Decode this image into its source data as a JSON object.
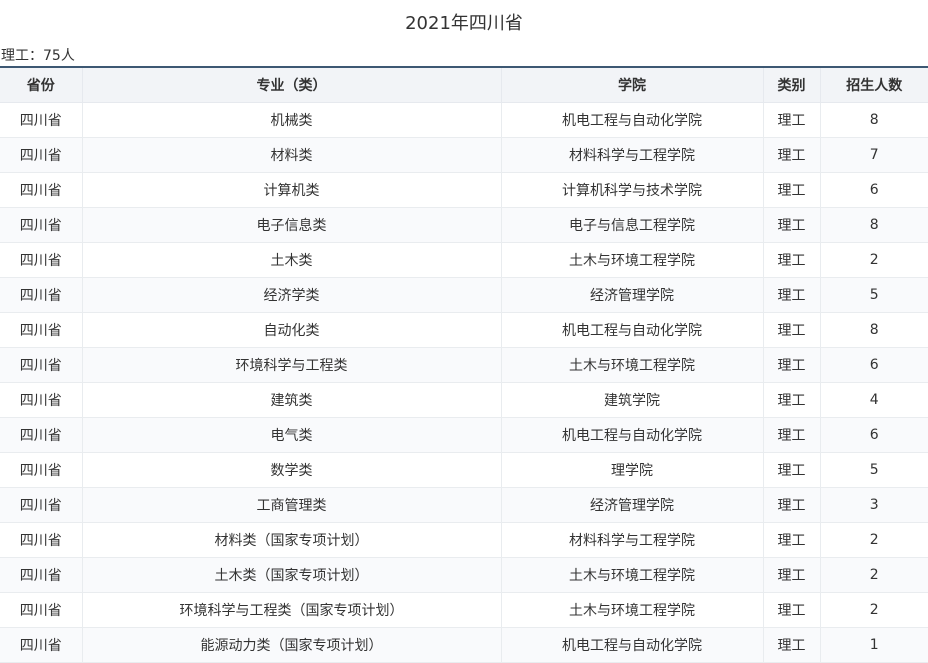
{
  "page": {
    "title": "2021年四川省",
    "summary": "理工：75人"
  },
  "table": {
    "headers": [
      "省份",
      "专业（类）",
      "学院",
      "类别",
      "招生人数"
    ],
    "rows": [
      [
        "四川省",
        "机械类",
        "机电工程与自动化学院",
        "理工",
        "8"
      ],
      [
        "四川省",
        "材料类",
        "材料科学与工程学院",
        "理工",
        "7"
      ],
      [
        "四川省",
        "计算机类",
        "计算机科学与技术学院",
        "理工",
        "6"
      ],
      [
        "四川省",
        "电子信息类",
        "电子与信息工程学院",
        "理工",
        "8"
      ],
      [
        "四川省",
        "土木类",
        "土木与环境工程学院",
        "理工",
        "2"
      ],
      [
        "四川省",
        "经济学类",
        "经济管理学院",
        "理工",
        "5"
      ],
      [
        "四川省",
        "自动化类",
        "机电工程与自动化学院",
        "理工",
        "8"
      ],
      [
        "四川省",
        "环境科学与工程类",
        "土木与环境工程学院",
        "理工",
        "6"
      ],
      [
        "四川省",
        "建筑类",
        "建筑学院",
        "理工",
        "4"
      ],
      [
        "四川省",
        "电气类",
        "机电工程与自动化学院",
        "理工",
        "6"
      ],
      [
        "四川省",
        "数学类",
        "理学院",
        "理工",
        "5"
      ],
      [
        "四川省",
        "工商管理类",
        "经济管理学院",
        "理工",
        "3"
      ],
      [
        "四川省",
        "材料类（国家专项计划）",
        "材料科学与工程学院",
        "理工",
        "2"
      ],
      [
        "四川省",
        "土木类（国家专项计划）",
        "土木与环境工程学院",
        "理工",
        "2"
      ],
      [
        "四川省",
        "环境科学与工程类（国家专项计划）",
        "土木与环境工程学院",
        "理工",
        "2"
      ],
      [
        "四川省",
        "能源动力类（国家专项计划）",
        "机电工程与自动化学院",
        "理工",
        "1"
      ]
    ]
  }
}
